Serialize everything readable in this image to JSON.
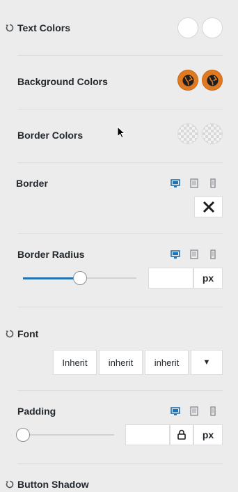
{
  "text_colors": {
    "label": "Text Colors"
  },
  "background_colors": {
    "label": "Background Colors"
  },
  "border_colors": {
    "label": "Border Colors"
  },
  "border": {
    "label": "Border",
    "close_glyph": "✕"
  },
  "border_radius": {
    "label": "Border Radius",
    "value": "",
    "unit": "px",
    "slider_fraction": 0.5
  },
  "font": {
    "label": "Font",
    "family": "Inherit",
    "weight": "inherit",
    "style": "inherit",
    "dropdown_glyph": "▼"
  },
  "padding": {
    "label": "Padding",
    "value": "",
    "unit": "px",
    "slider_fraction": 0
  },
  "button_shadow": {
    "label": "Button Shadow"
  },
  "colors": {
    "accent": "#2271b1",
    "swatch_orange": "#e07a22",
    "swatch_white": "#ffffff"
  }
}
